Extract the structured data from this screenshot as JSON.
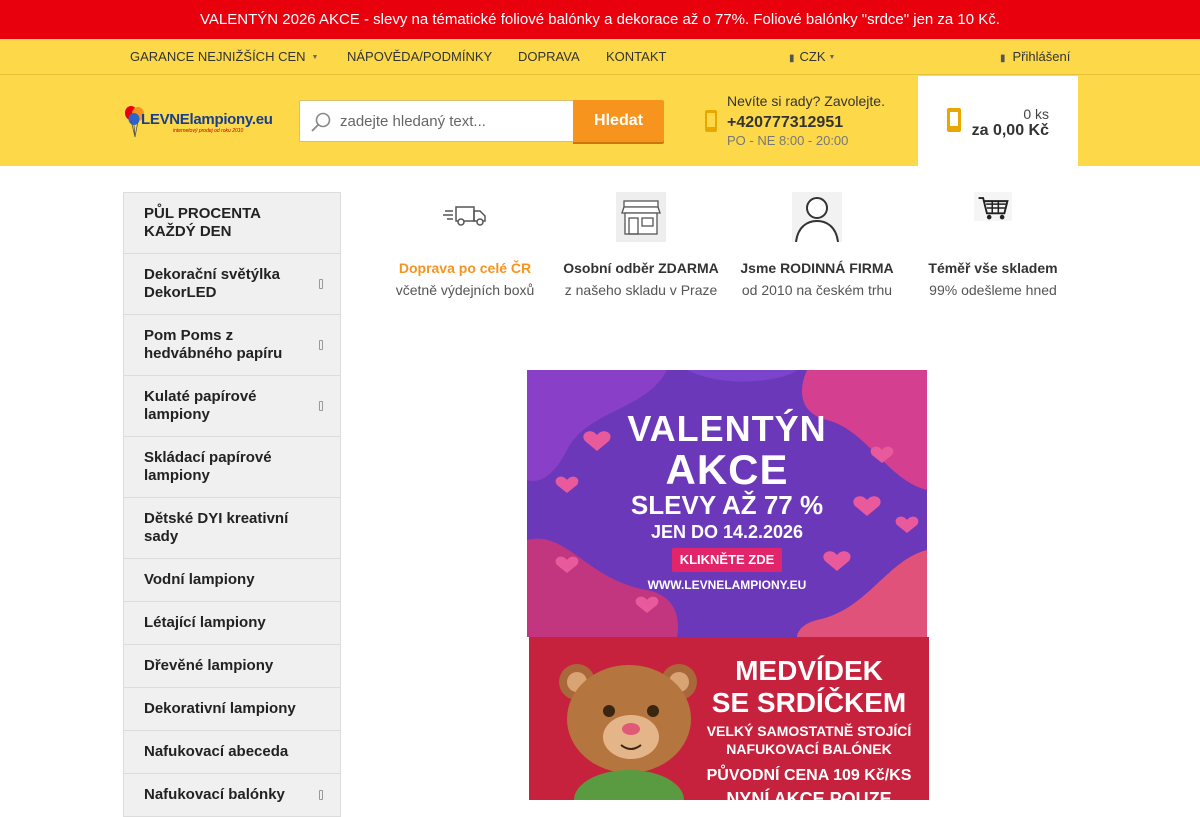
{
  "promo": {
    "text": "VALENTÝN 2026 AKCE - slevy na tématické foliové balónky a dekorace až o 77%. Foliové balónky \"srdce\" jen za 10 Kč."
  },
  "topnav": {
    "guarantee": "GARANCE NEJNIŽŠÍCH CEN",
    "help": "NÁPOVĚDA/PODMÍNKY",
    "shipping": "DOPRAVA",
    "contact": "KONTAKT",
    "currency": "CZK",
    "login": "Přihlášení"
  },
  "header": {
    "logo_main": "LEVNElampiony",
    "logo_eu": ".eu",
    "logo_tagline": "internetový prodej od roku 2010",
    "search_placeholder": "zadejte hledaný text...",
    "search_button": "Hledat",
    "advice_question": "Nevíte si rady? Zavolejte.",
    "phone": "+420777312951",
    "hours": "PO - NE 8:00 - 20:00",
    "cart_count": "0 ks",
    "cart_total": "za 0,00 Kč"
  },
  "sidebar": {
    "items": [
      {
        "label": "PŮL PROCENTA KAŽDÝ DEN",
        "sub": false,
        "tall": true
      },
      {
        "label": "Dekorační světýlka DekorLED",
        "sub": true,
        "tall": true
      },
      {
        "label": "Pom Poms z hedvábného papíru",
        "sub": true,
        "tall": true
      },
      {
        "label": "Kulaté papírové lampiony",
        "sub": true,
        "tall": true
      },
      {
        "label": "Skládací papírové lampiony",
        "sub": false,
        "tall": true
      },
      {
        "label": "Dětské DYI kreativní sady",
        "sub": false,
        "tall": true
      },
      {
        "label": "Vodní lampiony",
        "sub": false,
        "tall": false
      },
      {
        "label": "Létající lampiony",
        "sub": false,
        "tall": false
      },
      {
        "label": "Dřevěné lampiony",
        "sub": false,
        "tall": false
      },
      {
        "label": "Dekorativní lampiony",
        "sub": false,
        "tall": false
      },
      {
        "label": "Nafukovací abeceda",
        "sub": false,
        "tall": false
      },
      {
        "label": "Nafukovací balónky",
        "sub": true,
        "tall": false
      }
    ]
  },
  "features": [
    {
      "title": "Doprava po celé ČR",
      "subtitle": "včetně výdejních boxů",
      "icon": "truck-icon",
      "highlight": true
    },
    {
      "title": "Osobní odběr ZDARMA",
      "subtitle": "z našeho skladu v Praze",
      "icon": "store-icon",
      "highlight": false
    },
    {
      "title": "Jsme RODINNÁ FIRMA",
      "subtitle": "od 2010 na českém trhu",
      "icon": "person-icon",
      "highlight": false
    },
    {
      "title": "Téměř vše skladem",
      "subtitle": "99% odešleme hned",
      "icon": "cart-icon",
      "highlight": false
    }
  ],
  "banner_valentine": {
    "line1": "VALENTÝN",
    "line2": "AKCE",
    "line3": "SLEVY AŽ 77 %",
    "line4": "JEN DO 14.2.2026",
    "cta": "KLIKNĚTE ZDE",
    "url": "WWW.LEVNELAMPIONY.EU"
  },
  "banner_bear": {
    "line1": "MEDVÍDEK",
    "line2": "SE SRDÍČKEM",
    "line3": "VELKÝ SAMOSTATNĚ STOJÍCÍ",
    "line4": "NAFUKOVACÍ BALÓNEK",
    "line5": "PŮVODNÍ CENA 109 Kč/KS",
    "line6": "NYNÍ AKCE POUZE"
  },
  "colors": {
    "promo_red": "#e8000d",
    "header_yellow": "#fdd94a",
    "accent_orange": "#f7941d",
    "banner_purple": "#6a38b8",
    "banner_red": "#c7223d"
  }
}
